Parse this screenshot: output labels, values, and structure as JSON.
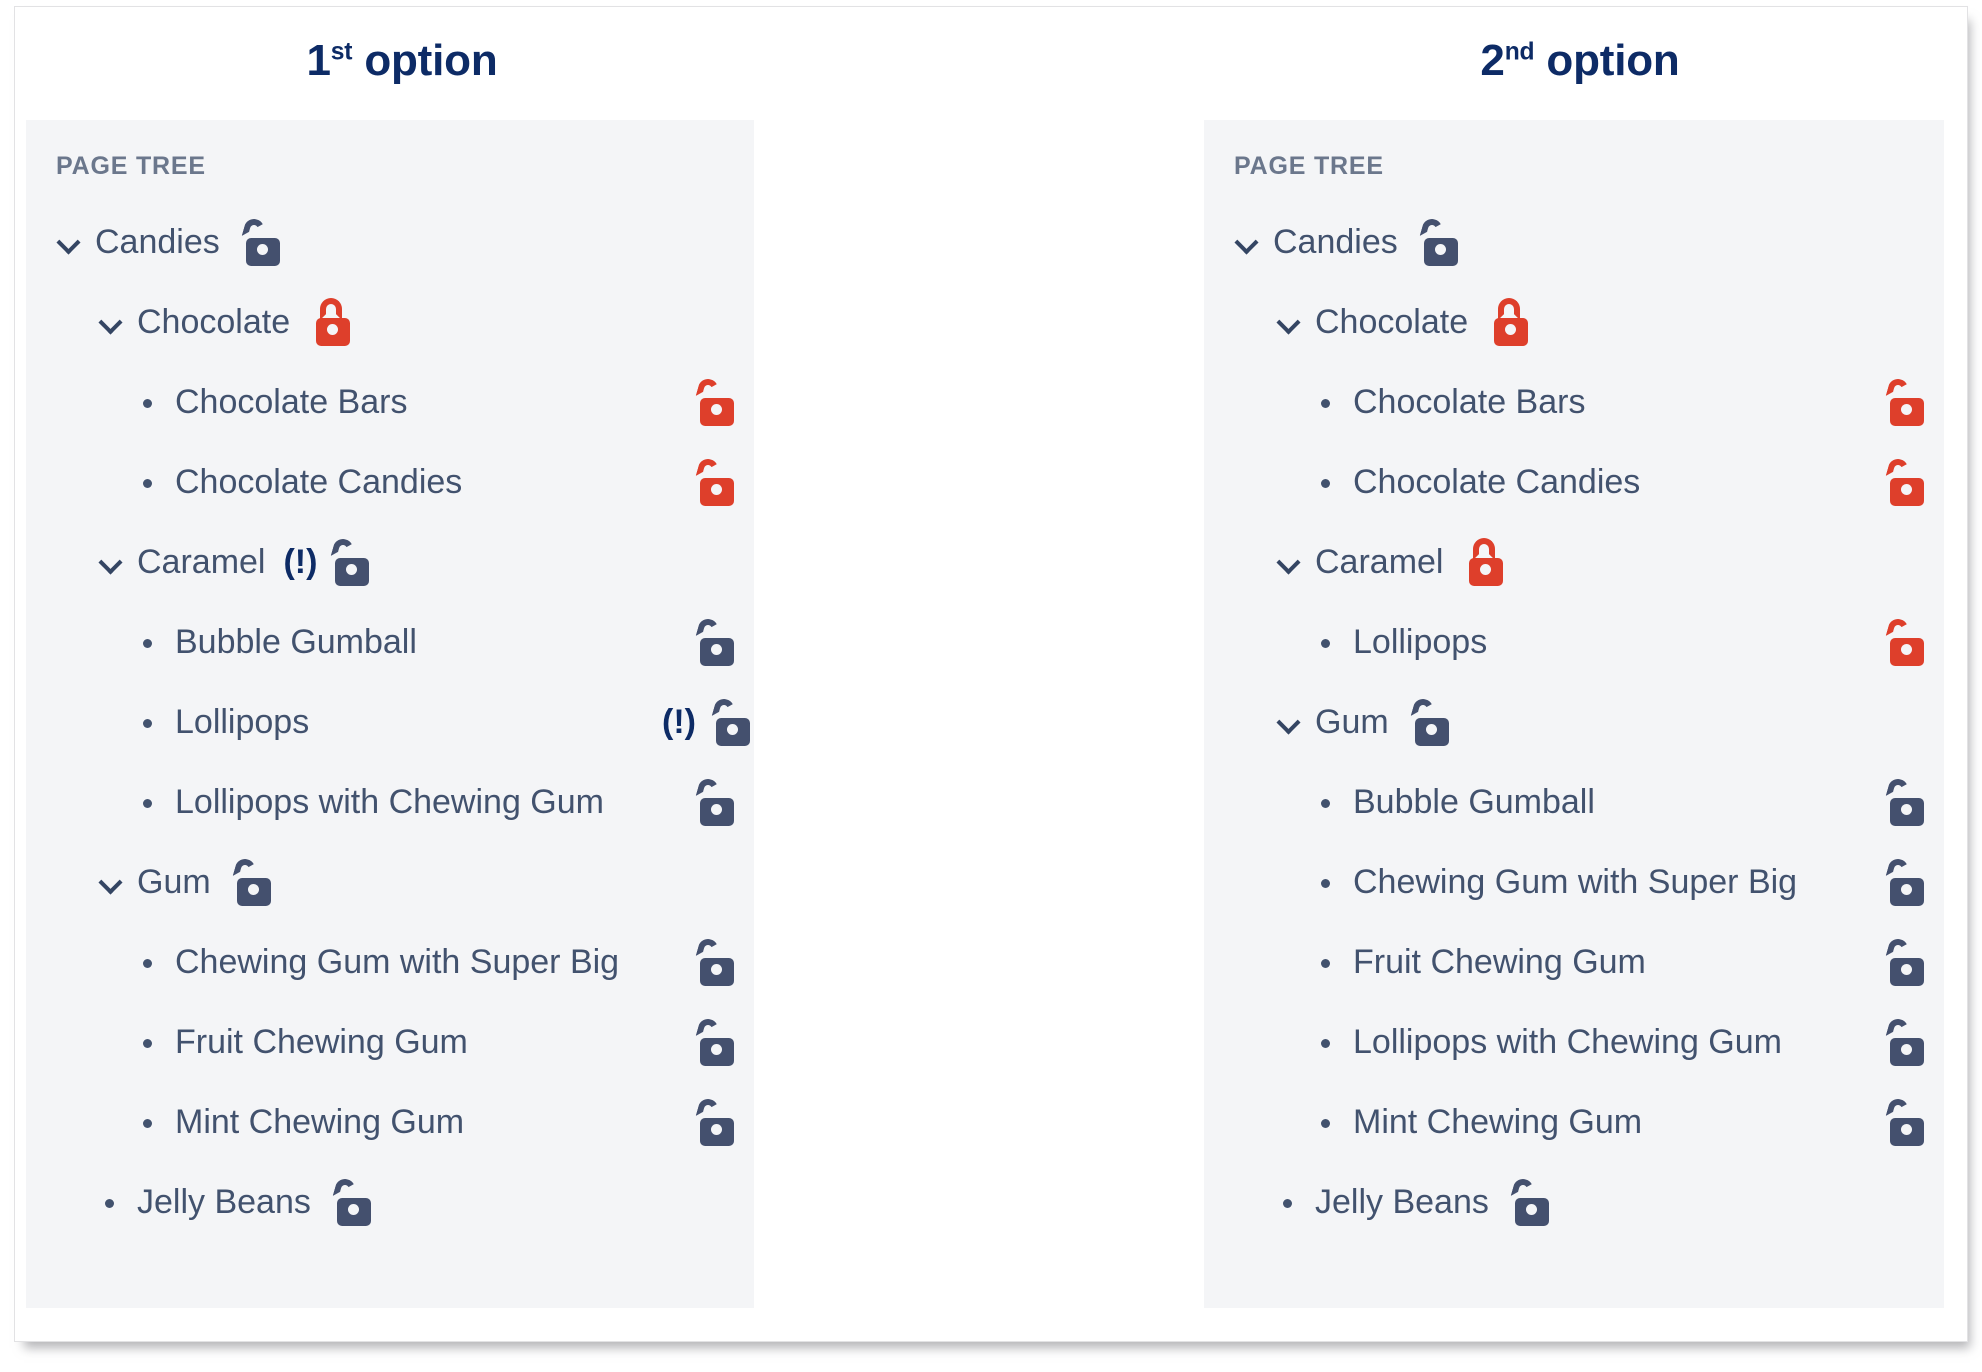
{
  "headings": {
    "option1": {
      "number": "1",
      "ordinal": "st",
      "word": "option"
    },
    "option2": {
      "number": "2",
      "ordinal": "nd",
      "word": "option"
    }
  },
  "colors": {
    "panel_background": "#f4f5f7",
    "page_background": "#ffffff",
    "heading_navy": "#0d2b66",
    "label_text": "#42526e",
    "panel_title_text": "#6b778c",
    "lock_navy": "#44506e",
    "lock_red": "#de3f2b",
    "card_border": "#e2e2e4"
  },
  "annotation_marker": "(!)",
  "panels": [
    {
      "id": "panel-1",
      "title": "PAGE TREE",
      "rows": [
        {
          "label": "Candies",
          "indent": 0,
          "marker": "chevron",
          "lock": "navy-open",
          "lock_position": "inline",
          "flag": false
        },
        {
          "label": "Chocolate",
          "indent": 1,
          "marker": "chevron",
          "lock": "red-closed",
          "lock_position": "inline",
          "flag": false
        },
        {
          "label": "Chocolate Bars",
          "indent": 2,
          "marker": "bullet",
          "lock": "red-open",
          "lock_position": "right",
          "flag": false
        },
        {
          "label": "Chocolate Candies",
          "indent": 2,
          "marker": "bullet",
          "lock": "red-open",
          "lock_position": "right",
          "flag": false
        },
        {
          "label": "Caramel",
          "indent": 1,
          "marker": "chevron",
          "lock": "navy-open",
          "lock_position": "inline",
          "flag": true
        },
        {
          "label": "Bubble Gumball",
          "indent": 2,
          "marker": "bullet",
          "lock": "navy-open",
          "lock_position": "right",
          "flag": false
        },
        {
          "label": "Lollipops",
          "indent": 2,
          "marker": "bullet",
          "lock": "navy-open",
          "lock_position": "right",
          "flag": true
        },
        {
          "label": "Lollipops with Chewing Gum",
          "indent": 2,
          "marker": "bullet",
          "lock": "navy-open",
          "lock_position": "right",
          "flag": false
        },
        {
          "label": "Gum",
          "indent": 1,
          "marker": "chevron",
          "lock": "navy-open",
          "lock_position": "inline",
          "flag": false
        },
        {
          "label": "Chewing Gum with Super Big",
          "indent": 2,
          "marker": "bullet",
          "lock": "navy-open",
          "lock_position": "right",
          "flag": false
        },
        {
          "label": "Fruit Chewing Gum",
          "indent": 2,
          "marker": "bullet",
          "lock": "navy-open",
          "lock_position": "right",
          "flag": false
        },
        {
          "label": "Mint Chewing Gum",
          "indent": 2,
          "marker": "bullet",
          "lock": "navy-open",
          "lock_position": "right",
          "flag": false
        },
        {
          "label": "Jelly Beans",
          "indent": 1,
          "marker": "bullet",
          "lock": "navy-open",
          "lock_position": "inline",
          "flag": false
        }
      ]
    },
    {
      "id": "panel-2",
      "title": "PAGE TREE",
      "rows": [
        {
          "label": "Candies",
          "indent": 0,
          "marker": "chevron",
          "lock": "navy-open",
          "lock_position": "inline",
          "flag": false
        },
        {
          "label": "Chocolate",
          "indent": 1,
          "marker": "chevron",
          "lock": "red-closed",
          "lock_position": "inline",
          "flag": false
        },
        {
          "label": "Chocolate Bars",
          "indent": 2,
          "marker": "bullet",
          "lock": "red-open",
          "lock_position": "right",
          "flag": false
        },
        {
          "label": "Chocolate Candies",
          "indent": 2,
          "marker": "bullet",
          "lock": "red-open",
          "lock_position": "right",
          "flag": false
        },
        {
          "label": "Caramel",
          "indent": 1,
          "marker": "chevron",
          "lock": "red-closed",
          "lock_position": "inline",
          "flag": false
        },
        {
          "label": "Lollipops",
          "indent": 2,
          "marker": "bullet",
          "lock": "red-open",
          "lock_position": "right",
          "flag": false
        },
        {
          "label": "Gum",
          "indent": 1,
          "marker": "chevron",
          "lock": "navy-open",
          "lock_position": "inline",
          "flag": false
        },
        {
          "label": "Bubble Gumball",
          "indent": 2,
          "marker": "bullet",
          "lock": "navy-open",
          "lock_position": "right",
          "flag": false
        },
        {
          "label": "Chewing Gum with Super Big ",
          "indent": 2,
          "marker": "bullet",
          "lock": "navy-open",
          "lock_position": "right",
          "flag": false
        },
        {
          "label": "Fruit Chewing Gum",
          "indent": 2,
          "marker": "bullet",
          "lock": "navy-open",
          "lock_position": "right",
          "flag": false
        },
        {
          "label": "Lollipops with Chewing Gum",
          "indent": 2,
          "marker": "bullet",
          "lock": "navy-open",
          "lock_position": "right",
          "flag": false
        },
        {
          "label": "Mint Chewing Gum",
          "indent": 2,
          "marker": "bullet",
          "lock": "navy-open",
          "lock_position": "right",
          "flag": false
        },
        {
          "label": "Jelly Beans",
          "indent": 1,
          "marker": "bullet",
          "lock": "navy-open",
          "lock_position": "inline",
          "flag": false
        }
      ]
    }
  ]
}
